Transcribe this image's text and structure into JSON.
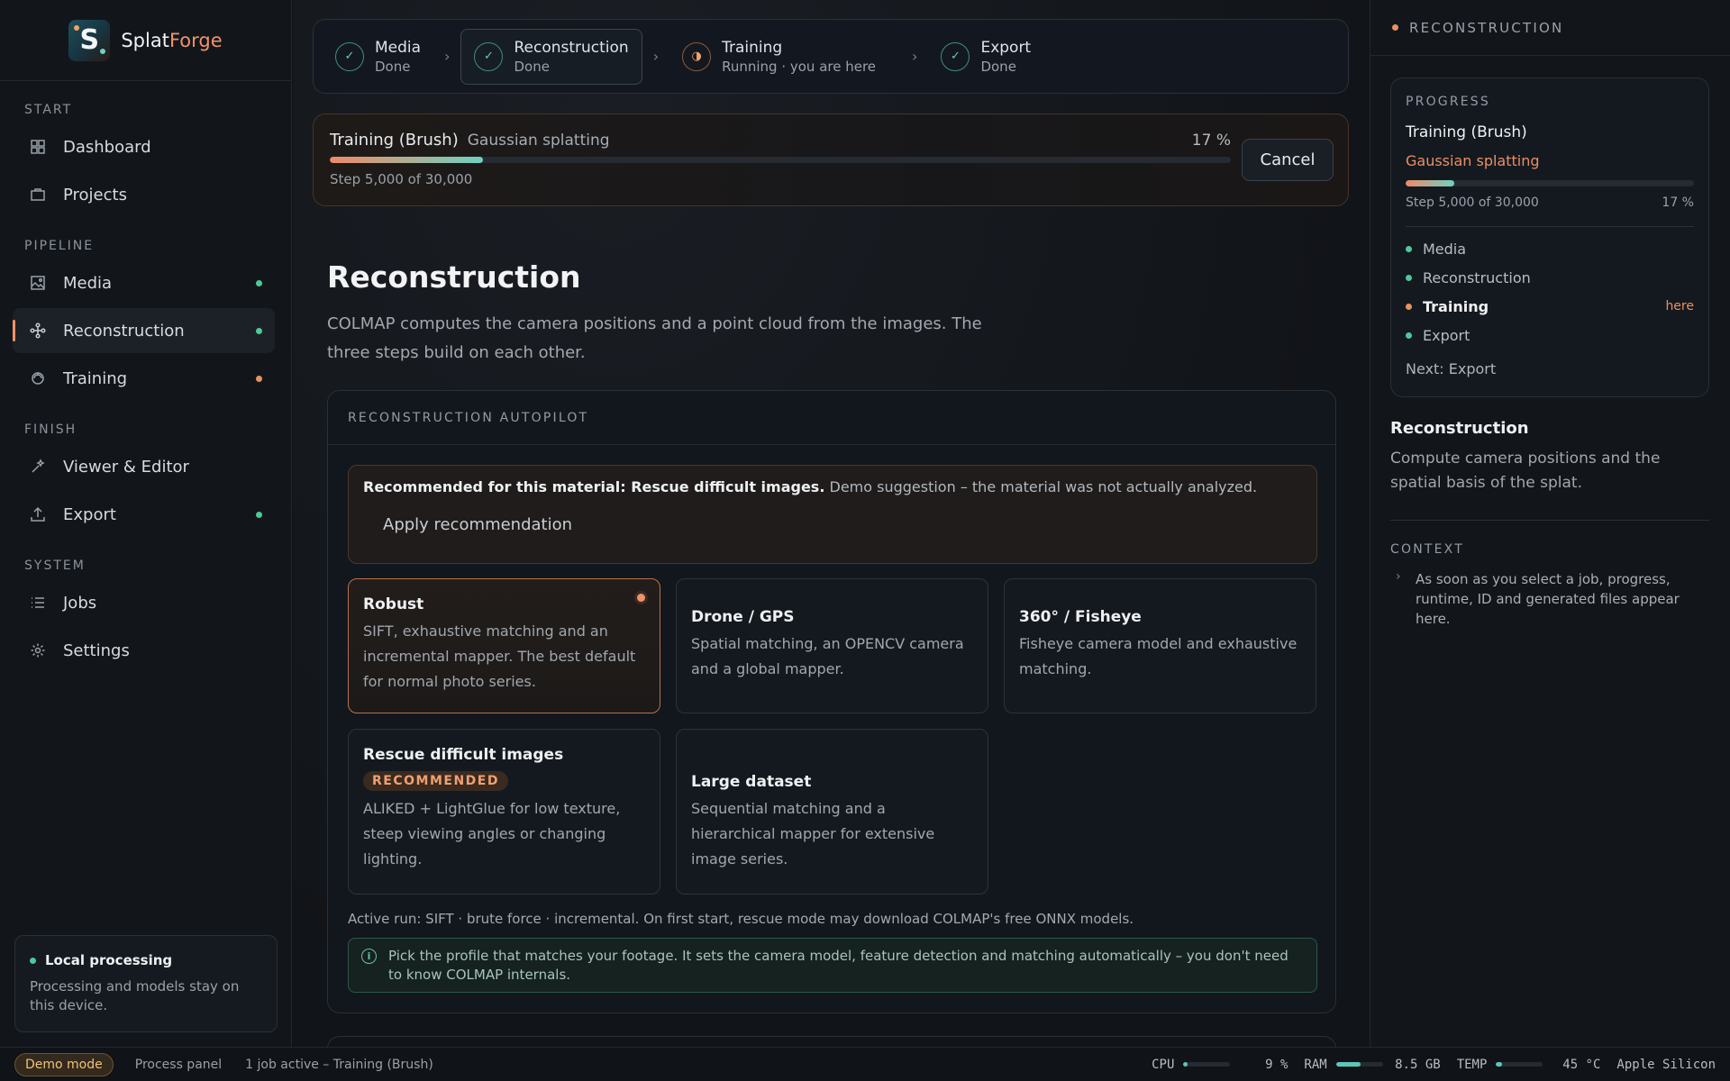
{
  "brand": {
    "name_a": "Splat",
    "name_b": "Forge",
    "logo_letter": "S"
  },
  "sidebar": {
    "sections": {
      "start": "START",
      "pipeline": "PIPELINE",
      "finish": "FINISH",
      "system": "SYSTEM"
    },
    "items": {
      "dashboard": "Dashboard",
      "projects": "Projects",
      "media": "Media",
      "reconstruction": "Reconstruction",
      "training": "Training",
      "viewer": "Viewer & Editor",
      "export": "Export",
      "jobs": "Jobs",
      "settings": "Settings"
    },
    "local": {
      "title": "Local processing",
      "text": "Processing and models stay on this device."
    }
  },
  "stepper": [
    {
      "title": "Media",
      "status": "Done"
    },
    {
      "title": "Reconstruction",
      "status": "Done"
    },
    {
      "title": "Training",
      "status": "Running · you are here"
    },
    {
      "title": "Export",
      "status": "Done"
    }
  ],
  "training_card": {
    "title": "Training (Brush)",
    "subtitle": "Gaussian splatting",
    "percent_label": "17 %",
    "progress": 0.17,
    "step_text": "Step 5,000 of 30,000",
    "cancel": "Cancel"
  },
  "page": {
    "title": "Reconstruction",
    "description": "COLMAP computes the camera positions and a point cloud from the images. The three steps build on each other."
  },
  "autopilot": {
    "header": "RECONSTRUCTION AUTOPILOT",
    "rec_bold": "Recommended for this material: Rescue difficult images.",
    "rec_note": " Demo suggestion – the material was not actually analyzed.",
    "apply": "Apply recommendation",
    "profiles": {
      "robust": {
        "title": "Robust",
        "text": "SIFT, exhaustive matching and an incremental mapper. The best default for normal photo series."
      },
      "drone": {
        "title": "Drone / GPS",
        "text": "Spatial matching, an OPENCV camera and a global mapper."
      },
      "fisheye": {
        "title": "360° / Fisheye",
        "text": "Fisheye camera model and exhaustive matching."
      },
      "rescue": {
        "title": "Rescue difficult images",
        "badge": "RECOMMENDED",
        "text": "ALIKED + LightGlue for low texture, steep viewing angles or changing lighting."
      },
      "large": {
        "title": "Large dataset",
        "text": "Sequential matching and a hierarchical mapper for extensive image series."
      }
    },
    "active_run": "Active run: SIFT · brute force · incremental. On first start, rescue mode may download COLMAP's free ONNX models.",
    "info": "Pick the profile that matches your footage. It sets the camera model, feature detection and matching automatically – you don't need to know COLMAP internals."
  },
  "right_panel": {
    "header": "RECONSTRUCTION",
    "progress": {
      "label": "PROGRESS",
      "title": "Training (Brush)",
      "subtitle": "Gaussian splatting",
      "step_text": "Step 5,000 of 30,000",
      "percent_label": "17 %",
      "progress": 0.17,
      "items": [
        "Media",
        "Reconstruction",
        "Training",
        "Export"
      ],
      "here": "here",
      "next": "Next: Export"
    },
    "section_title": "Reconstruction",
    "section_text": "Compute camera positions and the spatial basis of the splat.",
    "context_label": "CONTEXT",
    "context_text": "As soon as you select a job, progress, runtime, ID and generated files appear here."
  },
  "statusbar": {
    "demo": "Demo mode",
    "process_panel": "Process panel",
    "jobs": "1 job active – Training (Brush)",
    "cpu_label": "CPU",
    "cpu_value": "9 %",
    "cpu_level": 0.09,
    "ram_label": "RAM",
    "ram_value": "8.5 GB",
    "ram_level": 0.53,
    "temp_label": "TEMP",
    "temp_value": "45 °C",
    "temp_level": 0.12,
    "chip": "Apple Silicon"
  },
  "colors": {
    "accent": "#f0926a",
    "done": "#4fc79a",
    "running": "#e8935f"
  }
}
